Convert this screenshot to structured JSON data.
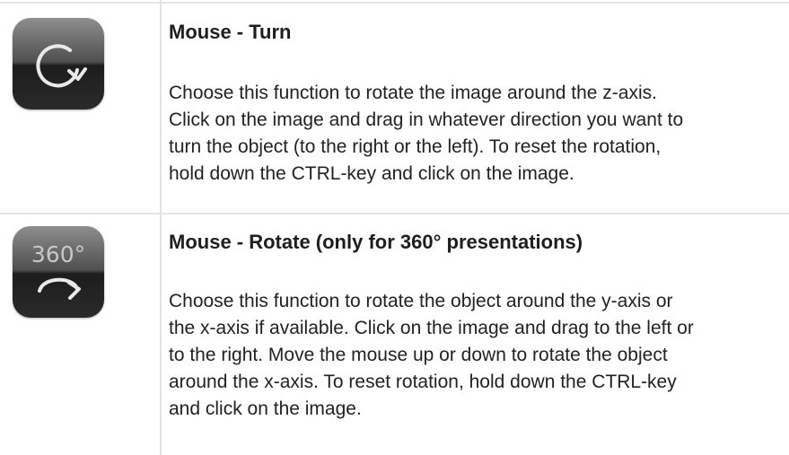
{
  "rows": [
    {
      "icon": "rotate-clockwise-icon",
      "title": "Mouse - Turn",
      "lines": [
        "Choose this function to rotate the image around the z-axis.",
        "Click on the image and drag in whatever direction you want to",
        "turn the object (to the right or the left). To reset the rotation,",
        "hold down the CTRL-key and click on the image."
      ]
    },
    {
      "icon": "rotate-360-icon",
      "icon_text": "360°",
      "title": "Mouse - Rotate (only for 360° presentations)",
      "lines": [
        "Choose this function to rotate the object around the y-axis or",
        "the x-axis if available. Click on the image and drag to the left or",
        "to the right. Move the mouse up or down to rotate the object",
        "around the x-axis. To reset rotation, hold down the CTRL-key",
        "and click on the image."
      ]
    }
  ]
}
